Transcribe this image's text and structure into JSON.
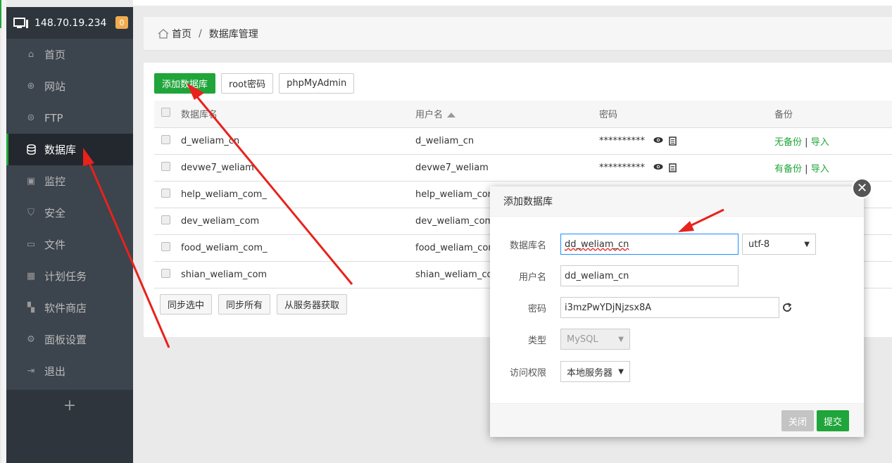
{
  "server": {
    "ip": "148.70.19.234",
    "badge": "0"
  },
  "sidebar": {
    "items": [
      {
        "label": "首页",
        "icon": "home-icon"
      },
      {
        "label": "网站",
        "icon": "globe-icon"
      },
      {
        "label": "FTP",
        "icon": "ftp-icon"
      },
      {
        "label": "数据库",
        "icon": "database-icon"
      },
      {
        "label": "监控",
        "icon": "monitor-icon"
      },
      {
        "label": "安全",
        "icon": "shield-icon"
      },
      {
        "label": "文件",
        "icon": "folder-icon"
      },
      {
        "label": "计划任务",
        "icon": "calendar-icon"
      },
      {
        "label": "软件商店",
        "icon": "apps-icon"
      },
      {
        "label": "面板设置",
        "icon": "gear-icon"
      },
      {
        "label": "退出",
        "icon": "logout-icon"
      }
    ],
    "plus": "+"
  },
  "breadcrumb": {
    "home": "首页",
    "sep": "/",
    "current": "数据库管理"
  },
  "toolbar": {
    "add_db": "添加数据库",
    "root_pwd": "root密码",
    "phpmyadmin": "phpMyAdmin"
  },
  "table": {
    "headers": {
      "name": "数据库名",
      "user": "用户名",
      "password": "密码",
      "backup": "备份"
    },
    "rows": [
      {
        "name": "d_weliam_cn",
        "user": "d_weliam_cn",
        "password": "**********",
        "backup": "无备份",
        "import": "导入"
      },
      {
        "name": "devwe7_weliam",
        "user": "devwe7_weliam",
        "password": "**********",
        "backup": "有备份",
        "import": "导入"
      },
      {
        "name": "help_weliam_com_",
        "user": "help_weliam_com_"
      },
      {
        "name": "dev_weliam_com",
        "user": "dev_weliam_com"
      },
      {
        "name": "food_weliam_com_",
        "user": "food_weliam_com_"
      },
      {
        "name": "shian_weliam_com",
        "user": "shian_weliam_com"
      }
    ],
    "sep": "|"
  },
  "bottom_buttons": {
    "sync_selected": "同步选中",
    "sync_all": "同步所有",
    "fetch_from_server": "从服务器获取"
  },
  "modal": {
    "title": "添加数据库",
    "close": "✕",
    "fields": {
      "db_name_label": "数据库名",
      "db_name_value": "dd_weliam_cn",
      "charset": "utf-8",
      "username_label": "用户名",
      "username_value": "dd_weliam_cn",
      "password_label": "密码",
      "password_value": "i3mzPwYDjNjzsx8A",
      "type_label": "类型",
      "type_value": "MySQL",
      "access_label": "访问权限",
      "access_value": "本地服务器"
    },
    "buttons": {
      "close": "关闭",
      "submit": "提交"
    }
  },
  "colors": {
    "accent": "#20a53a",
    "annotation": "#e8221c",
    "sidebar": "#3c444d"
  }
}
